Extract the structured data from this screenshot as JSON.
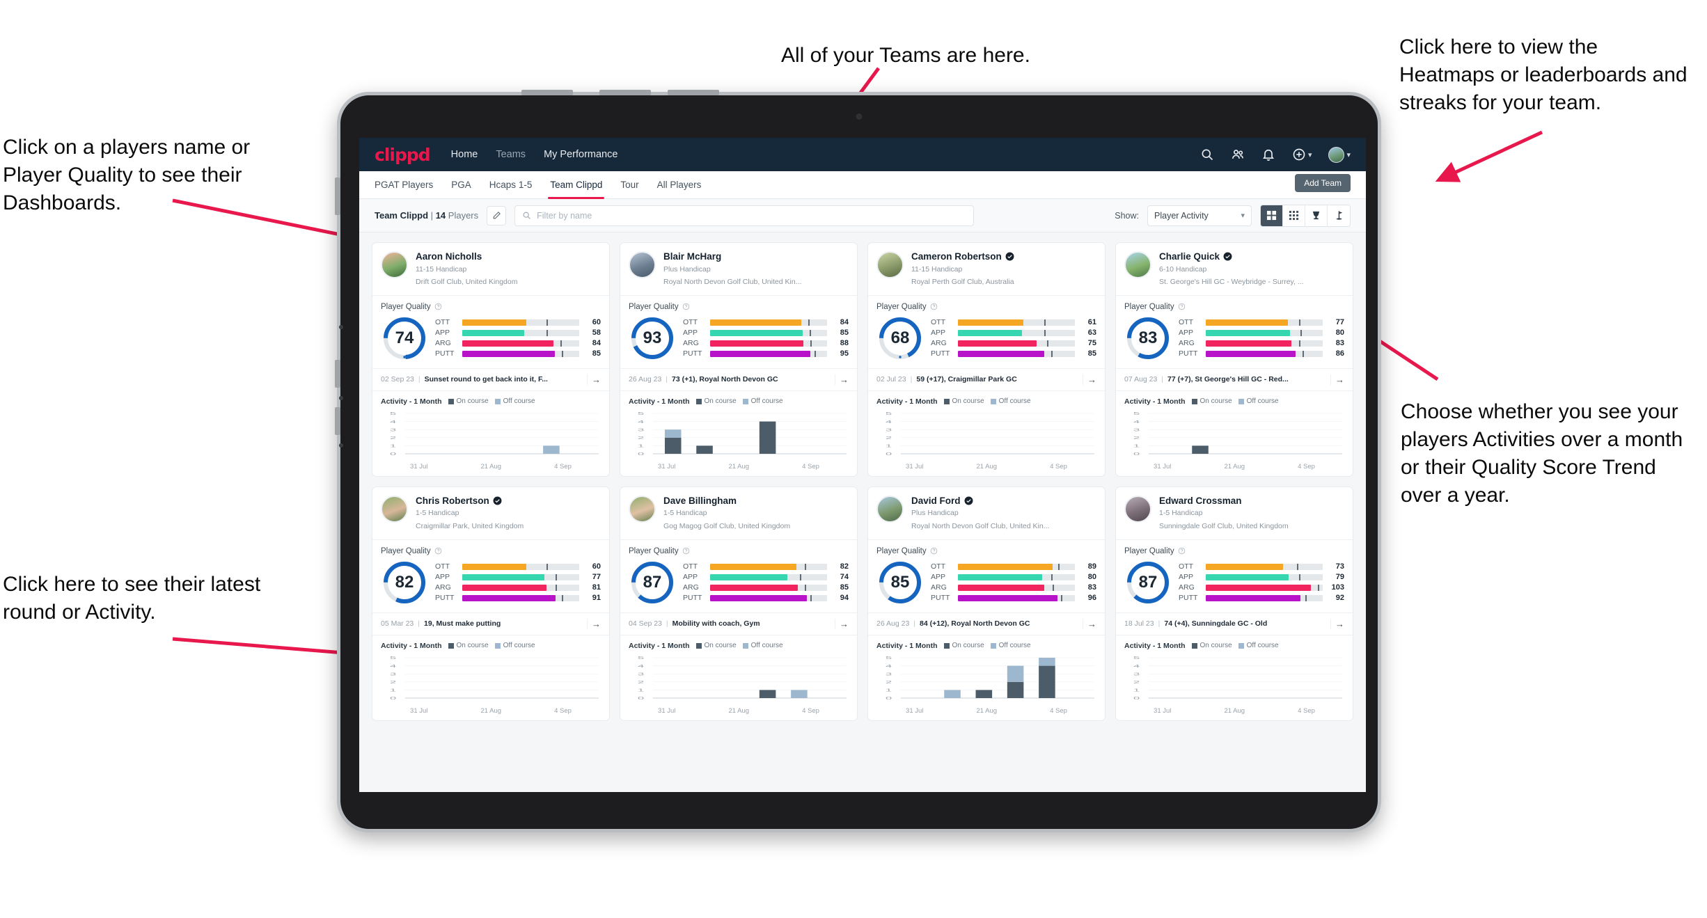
{
  "annotations": {
    "top_center": "All of your Teams are here.",
    "top_right": "Click here to view the Heatmaps or leaderboards and streaks for your team.",
    "left_top": "Click on a players name or Player Quality to see their Dashboards.",
    "right_mid": "Choose whether you see your players Activities over a month or their Quality Score Trend over a year.",
    "left_bottom": "Click here to see their latest round or Activity.",
    "accent_color": "#e8174c"
  },
  "app": {
    "brand": "clippd",
    "nav": [
      {
        "label": "Home",
        "active": true
      },
      {
        "label": "Teams",
        "active": false
      },
      {
        "label": "My Performance",
        "active": false
      }
    ],
    "header_icons": [
      "search-icon",
      "people-icon",
      "bell-icon",
      "plus-circle-icon",
      "avatar"
    ],
    "tabs": [
      {
        "label": "PGAT Players",
        "active": false
      },
      {
        "label": "PGA",
        "active": false
      },
      {
        "label": "Hcaps 1-5",
        "active": false
      },
      {
        "label": "Team Clippd",
        "active": true
      },
      {
        "label": "Tour",
        "active": false
      },
      {
        "label": "All Players",
        "active": false
      }
    ],
    "add_team_label": "Add Team",
    "filter": {
      "team_name": "Team Clippd",
      "separator": "|",
      "player_count": "14",
      "players_word": "Players",
      "edit_icon": "pencil-icon",
      "search_placeholder": "Filter by name",
      "show_label": "Show:",
      "show_value": "Player Activity",
      "view_modes": [
        {
          "name": "grid-large-icon",
          "active": true
        },
        {
          "name": "grid-small-icon",
          "active": false
        },
        {
          "name": "trophy-icon",
          "active": false
        },
        {
          "name": "flag-icon",
          "active": false
        }
      ]
    }
  },
  "card_labels": {
    "player_quality": "Player Quality",
    "activity_title": "Activity - 1 Month",
    "legend_on": "On course",
    "legend_off": "Off course",
    "skill_rows": [
      "OTT",
      "APP",
      "ARG",
      "PUTT"
    ],
    "xticks": [
      "31 Jul",
      "21 Aug",
      "4 Sep"
    ],
    "yticks": [
      "5",
      "4",
      "3",
      "2",
      "1",
      "0"
    ],
    "arrow": "→"
  },
  "colors": {
    "ott": "#f5a623",
    "app": "#35d6b0",
    "arg": "#f2245f",
    "putt": "#b913c9",
    "ring": "#1565c0",
    "ring_track": "#dfe4e8",
    "on_course": "#4c5c69",
    "off_course": "#9db8ce"
  },
  "players": [
    {
      "name": "Aaron Nicholls",
      "verified": false,
      "handicap": "11-15 Handicap",
      "club": "Drift Golf Club, United Kingdom",
      "quality": 74,
      "avatar": [
        "#f2b49a",
        "#7fae6b",
        "#3f6a3a"
      ],
      "skills": [
        {
          "label": "OTT",
          "value": 60,
          "fill": 55,
          "tick": 72
        },
        {
          "label": "APP",
          "value": 58,
          "fill": 53,
          "tick": 72
        },
        {
          "label": "ARG",
          "value": 84,
          "fill": 78,
          "tick": 84
        },
        {
          "label": "PUTT",
          "value": 85,
          "fill": 79,
          "tick": 85
        }
      ],
      "latest_date": "02 Sep 23",
      "latest_text": "Sunset round to get back into it, F...",
      "activity": [
        {
          "on": 0,
          "off": 0
        },
        {
          "on": 0,
          "off": 0
        },
        {
          "on": 0,
          "off": 0
        },
        {
          "on": 0,
          "off": 0
        },
        {
          "on": 0,
          "off": 1
        },
        {
          "on": 0,
          "off": 0
        }
      ]
    },
    {
      "name": "Blair McHarg",
      "verified": false,
      "handicap": "Plus Handicap",
      "club": "Royal North Devon Golf Club, United Kin...",
      "quality": 93,
      "avatar": [
        "#b8c6d4",
        "#6d7f92",
        "#4a5a6b"
      ],
      "skills": [
        {
          "label": "OTT",
          "value": 84,
          "fill": 78,
          "tick": 84
        },
        {
          "label": "APP",
          "value": 85,
          "fill": 79,
          "tick": 85
        },
        {
          "label": "ARG",
          "value": 88,
          "fill": 80,
          "tick": 86
        },
        {
          "label": "PUTT",
          "value": 95,
          "fill": 86,
          "tick": 89
        }
      ],
      "latest_date": "26 Aug 23",
      "latest_text": "73 (+1), Royal North Devon GC",
      "activity": [
        {
          "on": 2,
          "off": 1
        },
        {
          "on": 1,
          "off": 0
        },
        {
          "on": 0,
          "off": 0
        },
        {
          "on": 4,
          "off": 0
        },
        {
          "on": 0,
          "off": 0
        },
        {
          "on": 0,
          "off": 0
        }
      ]
    },
    {
      "name": "Cameron Robertson",
      "verified": true,
      "handicap": "11-15 Handicap",
      "club": "Royal Perth Golf Club, Australia",
      "quality": 68,
      "avatar": [
        "#cdd6a8",
        "#8b9b6a",
        "#5b6b45"
      ],
      "skills": [
        {
          "label": "OTT",
          "value": 61,
          "fill": 56,
          "tick": 74
        },
        {
          "label": "APP",
          "value": 63,
          "fill": 55,
          "tick": 74
        },
        {
          "label": "ARG",
          "value": 75,
          "fill": 67,
          "tick": 76
        },
        {
          "label": "PUTT",
          "value": 85,
          "fill": 74,
          "tick": 80
        }
      ],
      "latest_date": "02 Jul 23",
      "latest_text": "59 (+17), Craigmillar Park GC",
      "activity": [
        {
          "on": 0,
          "off": 0
        },
        {
          "on": 0,
          "off": 0
        },
        {
          "on": 0,
          "off": 0
        },
        {
          "on": 0,
          "off": 0
        },
        {
          "on": 0,
          "off": 0
        },
        {
          "on": 0,
          "off": 0
        }
      ]
    },
    {
      "name": "Charlie Quick",
      "verified": true,
      "handicap": "6-10 Handicap",
      "club": "St. George's Hill GC - Weybridge - Surrey, ...",
      "quality": 83,
      "avatar": [
        "#a9d4ef",
        "#86b46c",
        "#4d7a47"
      ],
      "skills": [
        {
          "label": "OTT",
          "value": 77,
          "fill": 70,
          "tick": 80
        },
        {
          "label": "APP",
          "value": 80,
          "fill": 72,
          "tick": 81
        },
        {
          "label": "ARG",
          "value": 83,
          "fill": 73,
          "tick": 80
        },
        {
          "label": "PUTT",
          "value": 86,
          "fill": 77,
          "tick": 83
        }
      ],
      "latest_date": "07 Aug 23",
      "latest_text": "77 (+7), St George's Hill GC - Red...",
      "activity": [
        {
          "on": 0,
          "off": 0
        },
        {
          "on": 1,
          "off": 0
        },
        {
          "on": 0,
          "off": 0
        },
        {
          "on": 0,
          "off": 0
        },
        {
          "on": 0,
          "off": 0
        },
        {
          "on": 0,
          "off": 0
        }
      ]
    },
    {
      "name": "Chris Robertson",
      "verified": true,
      "handicap": "1-5 Handicap",
      "club": "Craigmillar Park, United Kingdom",
      "quality": 82,
      "avatar": [
        "#8fae6e",
        "#d8b79a",
        "#5b7f4e"
      ],
      "skills": [
        {
          "label": "OTT",
          "value": 60,
          "fill": 55,
          "tick": 72
        },
        {
          "label": "APP",
          "value": 77,
          "fill": 70,
          "tick": 80
        },
        {
          "label": "ARG",
          "value": 81,
          "fill": 72,
          "tick": 80
        },
        {
          "label": "PUTT",
          "value": 91,
          "fill": 80,
          "tick": 85
        }
      ],
      "latest_date": "05 Mar 23",
      "latest_text": "19, Must make putting",
      "activity": [
        {
          "on": 0,
          "off": 0
        },
        {
          "on": 0,
          "off": 0
        },
        {
          "on": 0,
          "off": 0
        },
        {
          "on": 0,
          "off": 0
        },
        {
          "on": 0,
          "off": 0
        },
        {
          "on": 0,
          "off": 0
        }
      ]
    },
    {
      "name": "Dave Billingham",
      "verified": false,
      "handicap": "1-5 Handicap",
      "club": "Gog Magog Golf Club, United Kingdom",
      "quality": 87,
      "avatar": [
        "#8fae6e",
        "#e0c0a4",
        "#64804f"
      ],
      "skills": [
        {
          "label": "OTT",
          "value": 82,
          "fill": 74,
          "tick": 81
        },
        {
          "label": "APP",
          "value": 74,
          "fill": 66,
          "tick": 77
        },
        {
          "label": "ARG",
          "value": 85,
          "fill": 75,
          "tick": 81
        },
        {
          "label": "PUTT",
          "value": 94,
          "fill": 83,
          "tick": 86
        }
      ],
      "latest_date": "04 Sep 23",
      "latest_text": "Mobility with coach, Gym",
      "activity": [
        {
          "on": 0,
          "off": 0
        },
        {
          "on": 0,
          "off": 0
        },
        {
          "on": 0,
          "off": 0
        },
        {
          "on": 1,
          "off": 0
        },
        {
          "on": 0,
          "off": 1
        },
        {
          "on": 0,
          "off": 0
        }
      ]
    },
    {
      "name": "David Ford",
      "verified": true,
      "handicap": "Plus Handicap",
      "club": "Royal North Devon Golf Club, United Kin...",
      "quality": 85,
      "avatar": [
        "#a8c8e0",
        "#7e9a6f",
        "#4f6b4a"
      ],
      "skills": [
        {
          "label": "OTT",
          "value": 89,
          "fill": 81,
          "tick": 86
        },
        {
          "label": "APP",
          "value": 80,
          "fill": 72,
          "tick": 80
        },
        {
          "label": "ARG",
          "value": 83,
          "fill": 74,
          "tick": 81
        },
        {
          "label": "PUTT",
          "value": 96,
          "fill": 85,
          "tick": 88
        }
      ],
      "latest_date": "26 Aug 23",
      "latest_text": "84 (+12), Royal North Devon GC",
      "activity": [
        {
          "on": 0,
          "off": 0
        },
        {
          "on": 0,
          "off": 1
        },
        {
          "on": 1,
          "off": 0
        },
        {
          "on": 2,
          "off": 2
        },
        {
          "on": 4,
          "off": 1
        },
        {
          "on": 0,
          "off": 0
        }
      ]
    },
    {
      "name": "Edward Crossman",
      "verified": false,
      "handicap": "1-5 Handicap",
      "club": "Sunningdale Golf Club, United Kingdom",
      "quality": 87,
      "avatar": [
        "#b9aeb8",
        "#7d6f78",
        "#4f474f"
      ],
      "skills": [
        {
          "label": "OTT",
          "value": 73,
          "fill": 66,
          "tick": 78
        },
        {
          "label": "APP",
          "value": 79,
          "fill": 71,
          "tick": 80
        },
        {
          "label": "ARG",
          "value": 103,
          "fill": 90,
          "tick": 96
        },
        {
          "label": "PUTT",
          "value": 92,
          "fill": 81,
          "tick": 85
        }
      ],
      "latest_date": "18 Jul 23",
      "latest_text": "74 (+4), Sunningdale GC - Old",
      "activity": [
        {
          "on": 0,
          "off": 0
        },
        {
          "on": 0,
          "off": 0
        },
        {
          "on": 0,
          "off": 0
        },
        {
          "on": 0,
          "off": 0
        },
        {
          "on": 0,
          "off": 0
        },
        {
          "on": 0,
          "off": 0
        }
      ]
    }
  ]
}
